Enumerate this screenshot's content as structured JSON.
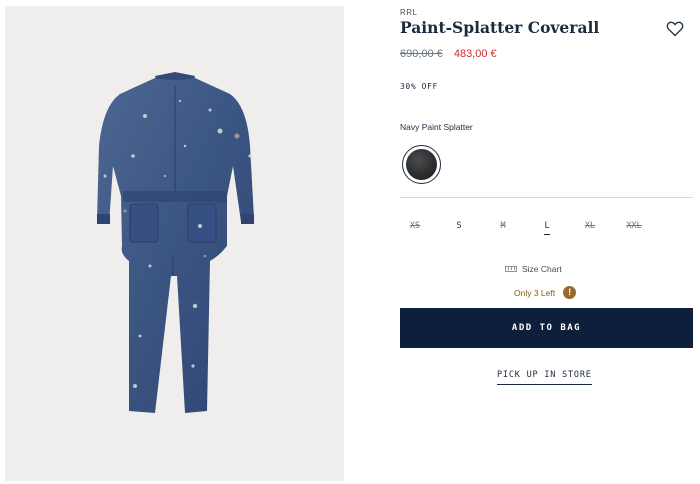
{
  "product": {
    "brand": "RRL",
    "title": "Paint-Splatter Coverall",
    "price_original": "690,00 €",
    "price_sale": "483,00 €",
    "discount": "30% OFF",
    "color_name": "Navy Paint Splatter",
    "image_icon": "coverall-product-image"
  },
  "sizes": [
    {
      "label": "XS",
      "available": false,
      "selected": false
    },
    {
      "label": "S",
      "available": true,
      "selected": false
    },
    {
      "label": "M",
      "available": false,
      "selected": false
    },
    {
      "label": "L",
      "available": true,
      "selected": true
    },
    {
      "label": "XL",
      "available": false,
      "selected": false
    },
    {
      "label": "XXL",
      "available": false,
      "selected": false
    }
  ],
  "size_chart_label": "Size Chart",
  "stock_label": "Only 3 Left",
  "stock_icon": "!",
  "add_to_bag_label": "ADD TO BAG",
  "pickup_label": "PICK UP IN STORE",
  "colors": {
    "navy_button": "#0e1f3b",
    "sale_price": "#d22b2b",
    "stock_warning": "#9a6a2a"
  }
}
